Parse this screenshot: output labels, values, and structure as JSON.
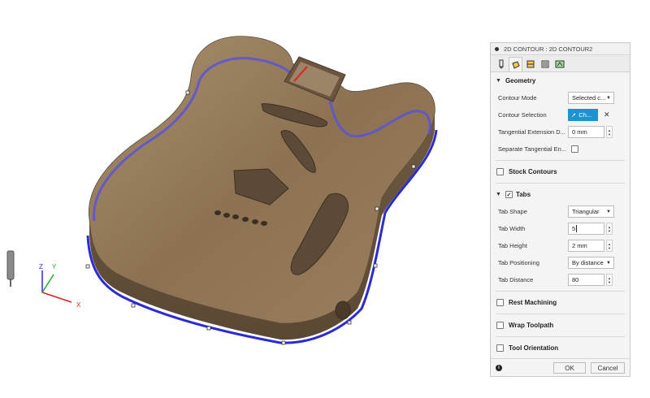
{
  "panel": {
    "title": "2D CONTOUR : 2D CONTOUR2",
    "tabs": [
      "tool-tab",
      "geometry-tab",
      "heights-tab",
      "passes-tab",
      "linking-tab"
    ],
    "geometry": {
      "header": "Geometry",
      "contour_mode_label": "Contour Mode",
      "contour_mode_value": "Selected c...",
      "contour_selection_label": "Contour Selection",
      "contour_selection_value": "Ch...",
      "tangential_extension_label": "Tangential Extension D...",
      "tangential_extension_value": "0 mm",
      "separate_tangential_label": "Separate Tangential En...",
      "separate_tangential_checked": false
    },
    "stock_contours_label": "Stock Contours",
    "tabs_section": {
      "header": "Tabs",
      "checked": true,
      "tab_shape_label": "Tab Shape",
      "tab_shape_value": "Triangular",
      "tab_width_label": "Tab Width",
      "tab_width_value": "5",
      "tab_height_label": "Tab Height",
      "tab_height_value": "2 mm",
      "tab_positioning_label": "Tab Positioning",
      "tab_positioning_value": "By distance",
      "tab_distance_label": "Tab Distance",
      "tab_distance_value": "80"
    },
    "rest_machining_label": "Rest Machining",
    "wrap_toolpath_label": "Wrap Toolpath",
    "tool_orientation_label": "Tool Orientation",
    "ok_label": "OK",
    "cancel_label": "Cancel"
  },
  "viewport": {
    "triad": {
      "z": "Z",
      "y": "Y",
      "x": "X"
    },
    "colors": {
      "wood": "#8b7152",
      "toolpath": "#3f3fd8",
      "accent": "#1d93d4"
    }
  }
}
